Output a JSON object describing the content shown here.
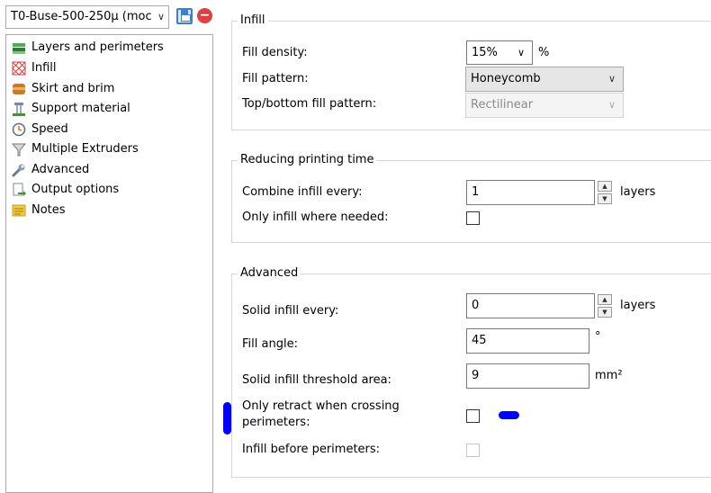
{
  "preset": {
    "value": "T0-Buse-500-250µ (moc",
    "arrow": "∨",
    "delete_glyph": "−"
  },
  "sidebar": {
    "items": [
      {
        "label": "Layers and perimeters",
        "icon": "layers-icon"
      },
      {
        "label": "Infill",
        "icon": "infill-icon"
      },
      {
        "label": "Skirt and brim",
        "icon": "skirt-icon"
      },
      {
        "label": "Support material",
        "icon": "support-icon"
      },
      {
        "label": "Speed",
        "icon": "clock-icon"
      },
      {
        "label": "Multiple Extruders",
        "icon": "funnel-icon"
      },
      {
        "label": "Advanced",
        "icon": "wrench-icon"
      },
      {
        "label": "Output options",
        "icon": "output-icon"
      },
      {
        "label": "Notes",
        "icon": "note-icon"
      }
    ]
  },
  "infill": {
    "title": "Infill",
    "fill_density": {
      "label": "Fill density:",
      "value": "15%",
      "arrow": "∨",
      "unit": "%"
    },
    "fill_pattern": {
      "label": "Fill pattern:",
      "value": "Honeycomb",
      "arrow": "∨"
    },
    "top_bottom": {
      "label": "Top/bottom fill pattern:",
      "value": "Rectilinear",
      "arrow": "∨"
    }
  },
  "reducing": {
    "title": "Reducing printing time",
    "combine": {
      "label": "Combine infill every:",
      "value": "1",
      "unit": "layers"
    },
    "only_infill": {
      "label": "Only infill where needed:"
    }
  },
  "advanced": {
    "title": "Advanced",
    "solid_every": {
      "label": "Solid infill every:",
      "value": "0",
      "unit": "layers"
    },
    "fill_angle": {
      "label": "Fill angle:",
      "value": "45",
      "unit": "°"
    },
    "threshold": {
      "label": "Solid infill threshold area:",
      "value": "9",
      "unit": "mm²"
    },
    "only_retract": {
      "label_line1": "Only retract when crossing",
      "label_line2": "perimeters:"
    },
    "infill_before": {
      "label": "Infill before perimeters:"
    }
  },
  "spin": {
    "up": "▲",
    "down": "▼"
  },
  "colors": {
    "marker": "#0000ff"
  }
}
